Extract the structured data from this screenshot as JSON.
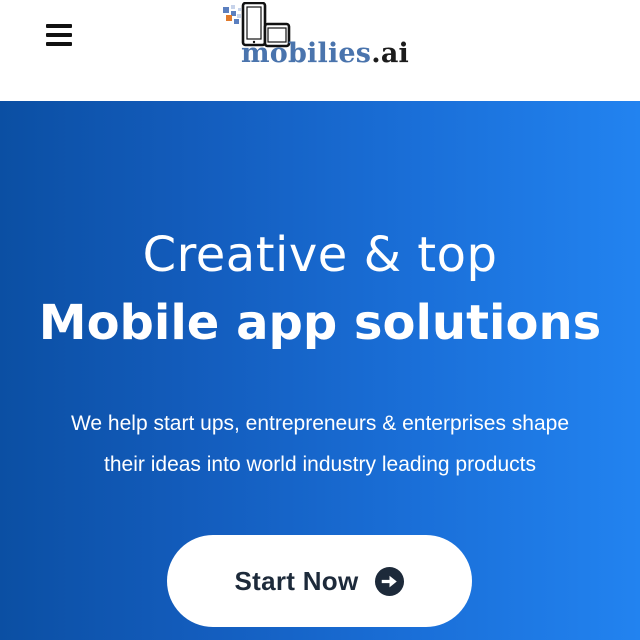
{
  "header": {
    "menu_icon": "hamburger-menu-icon",
    "logo": {
      "brand": "mobilies",
      "tld": ".ai",
      "icon": "mobile-devices-logo-icon",
      "colors": {
        "brand_text": "#4a74ad",
        "tld_text": "#1c1c1c",
        "pixel_blue": "#5b7fbf",
        "pixel_orange": "#e07a2c",
        "pixel_light": "#c7d3ea",
        "device_outline": "#111111"
      }
    }
  },
  "hero": {
    "title_line1": "Creative & top",
    "title_line2": "Mobile app solutions",
    "subtitle_line1": "We help start ups, entrepreneurs & enterprises shape",
    "subtitle_line2": "their ideas into world industry leading products",
    "cta_label": "Start Now",
    "cta_icon": "arrow-right-circle-icon",
    "colors": {
      "gradient_start": "#0b4fa3",
      "gradient_end": "#2283f0",
      "text": "#ffffff",
      "cta_background": "#ffffff",
      "cta_text": "#1d2a3a"
    }
  }
}
